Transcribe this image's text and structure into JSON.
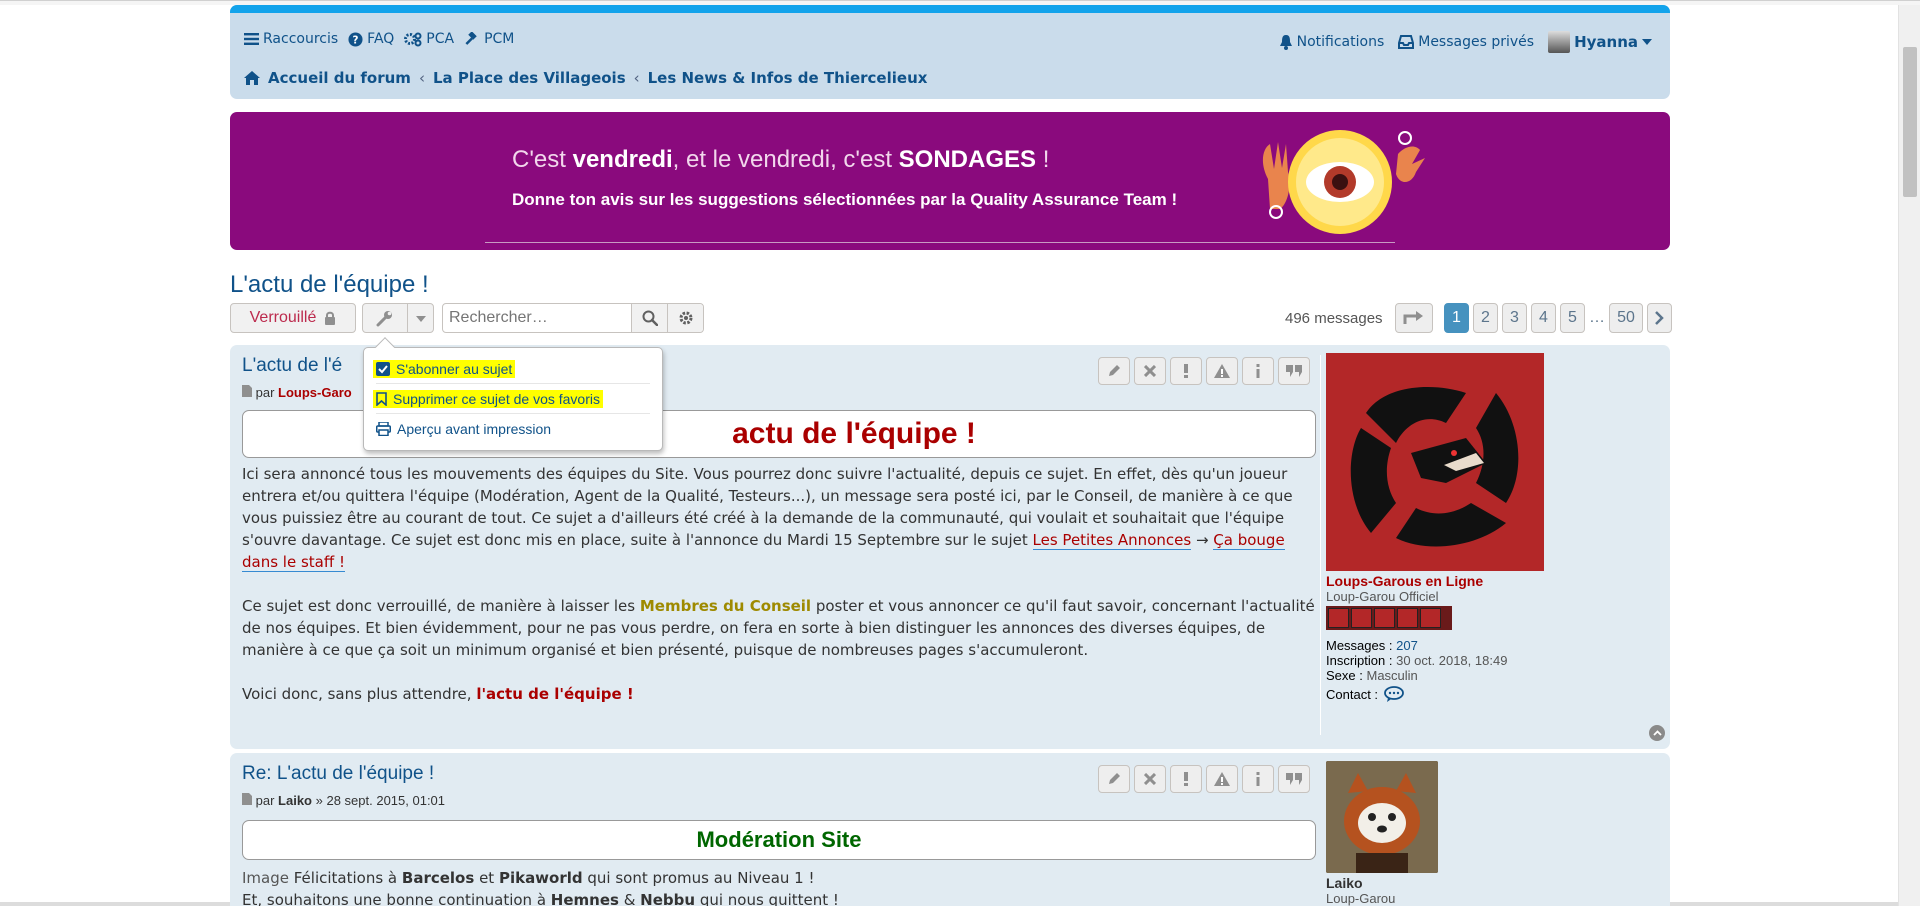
{
  "nav": {
    "shortcuts": "Raccourcis",
    "faq": "FAQ",
    "pca": "PCA",
    "pcm": "PCM",
    "notifications": "Notifications",
    "private_messages": "Messages privés",
    "username": "Hyanna"
  },
  "breadcrumbs": [
    "Accueil du forum",
    "La Place des Villageois",
    "Les News & Infos de Thiercelieux"
  ],
  "banner": {
    "line1_a": "C'est ",
    "line1_b": "vendredi",
    "line1_c": ", et le vendredi, c'est ",
    "line1_d": "SONDAGES",
    "line1_e": " !",
    "line2": "Donne ton avis sur les suggestions sélectionnées par la Quality Assurance Team !"
  },
  "topic": {
    "title": "L'actu de l'équipe !",
    "locked_label": "Verrouillé",
    "search_placeholder": "Rechercher…",
    "message_count": "496 messages",
    "pages": [
      "1",
      "2",
      "3",
      "4",
      "5",
      "…",
      "50"
    ]
  },
  "dropdown": {
    "subscribe": "S'abonner au sujet",
    "unbookmark": "Supprimer ce sujet de vos favoris",
    "print": "Aperçu avant impression"
  },
  "post1": {
    "title": "L'actu de l'é",
    "by": "par",
    "author": "Loups-Garo",
    "box_title": "actu de l'équipe !",
    "p1_a": "Ici sera annoncé tous les mouvements des équipes du Site. Vous pourrez donc suivre l'actualité, depuis ce sujet. En effet, dès qu'un joueur entrera et/ou quittera l'équipe (Modération, Agent de la Qualité, Testeurs...), un message sera posté ici, par le Conseil, de manière à ce que vous puissiez être au courant de tout. Ce sujet a d'ailleurs été créé à la demande de la communauté, qui voulait et souhaitait que l'équipe s'ouvre davantage. Ce sujet est donc mis en place, suite à l'annonce du Mardi 15 Septembre sur le sujet ",
    "p1_link1": "Les Petites Annonces",
    "p1_arrow": " → ",
    "p1_link2": "Ça bouge dans le staff !",
    "p2_a": "Ce sujet est donc verrouillé, de manière à laisser les ",
    "p2_gold": "Membres du Conseil",
    "p2_b": " poster et vous annoncer ce qu'il faut savoir, concernant l'actualité de nos équipes. Et bien évidemment, pour ne pas vous perdre, on fera en sorte à bien distinguer les annonces des diverses équipes, de manière à ce que ça soit un minimum organisé et bien présenté, puisque de nombreuses pages s'accumuleront.",
    "p3_a": "Voici donc, sans plus attendre, ",
    "p3_red": "l'actu de l'équipe !",
    "profile": {
      "name": "Loups-Garous en Ligne",
      "rank": "Loup-Garou Officiel",
      "messages_label": "Messages :",
      "messages_value": "207",
      "joined_label": "Inscription :",
      "joined_value": "30 oct. 2018, 18:49",
      "sex_label": "Sexe :",
      "sex_value": "Masculin",
      "contact_label": "Contact :"
    }
  },
  "post2": {
    "title": "Re: L'actu de l'équipe !",
    "by": "par",
    "author": "Laiko",
    "date": " » 28 sept. 2015, 01:01",
    "box_title": "Modération Site",
    "l1_img": "Image",
    "l1_a": " Félicitations à ",
    "l1_b": "Barcelos",
    "l1_c": " et ",
    "l1_d": "Pikaworld",
    "l1_e": " qui sont promus au Niveau 1 !",
    "l2_a": "Et, souhaitons une bonne continuation à ",
    "l2_b": "Hemnes",
    "l2_c": " & ",
    "l2_d": "Nebbu",
    "l2_e": " qui nous quittent !",
    "profile": {
      "name": "Laiko",
      "rank": "Loup-Garou"
    }
  },
  "colors": {
    "link": "#105289",
    "post_bg": "#e1ebf2",
    "banner": "#8a0a7d",
    "highlight": "#ffff00",
    "active_page": "#4692bf"
  }
}
